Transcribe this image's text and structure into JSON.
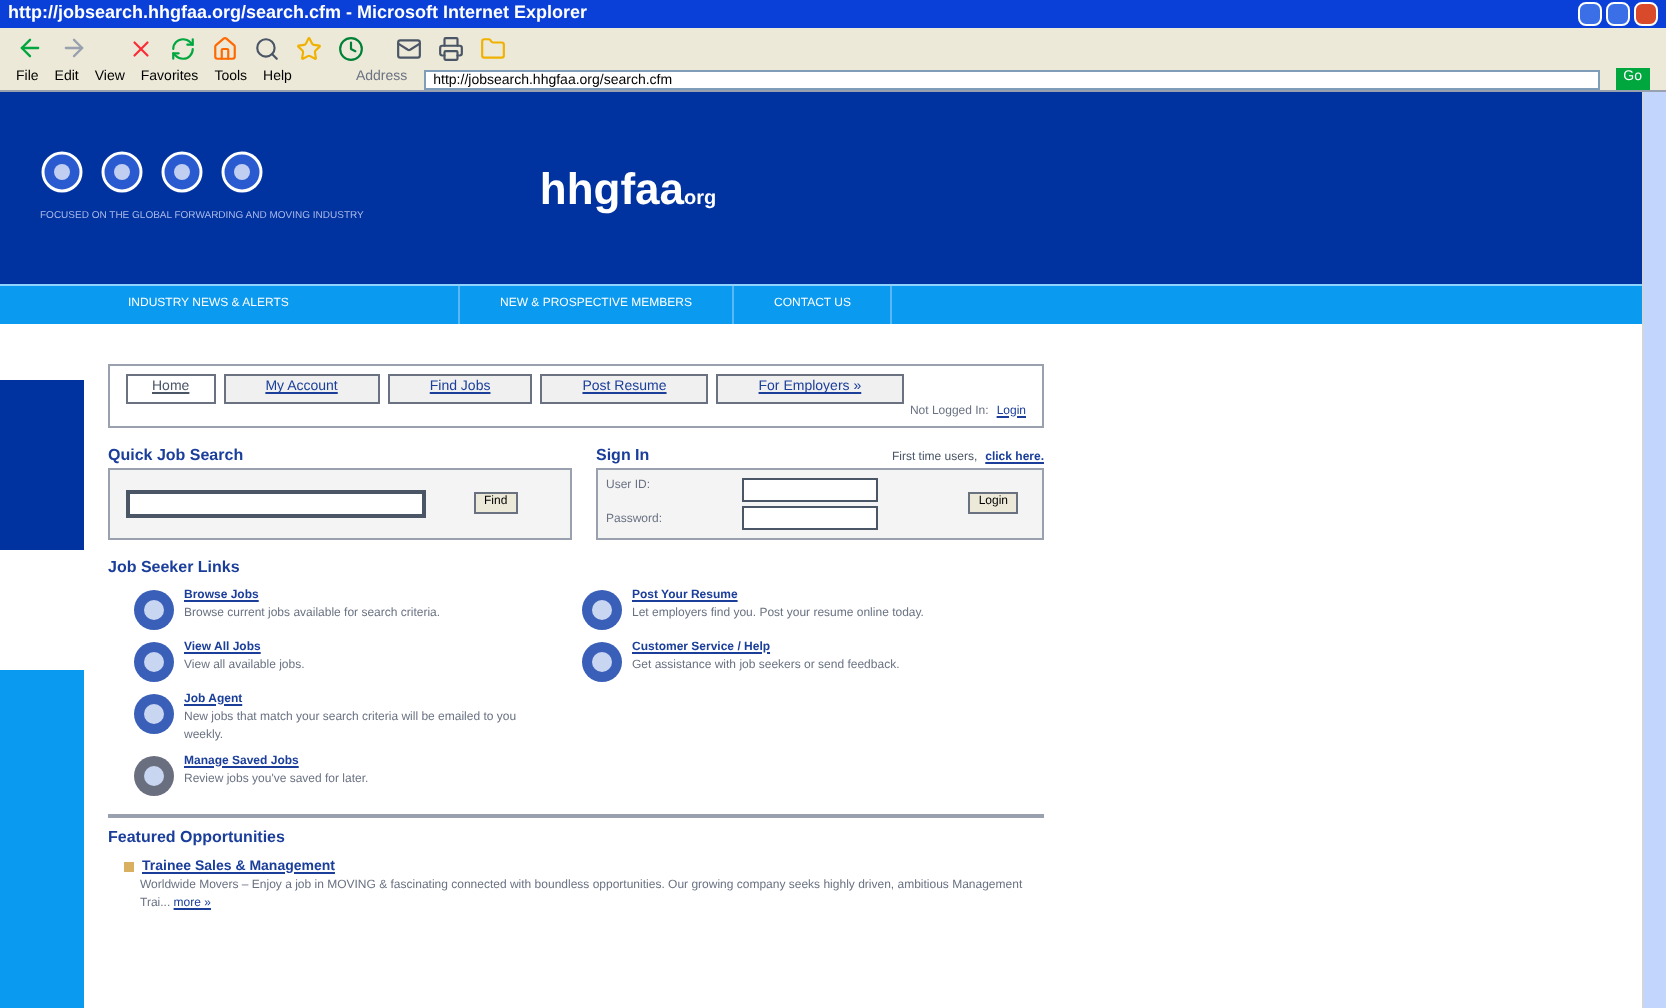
{
  "window": {
    "title": "http://jobsearch.hhgfaa.org/search.cfm - Microsoft Internet Explorer"
  },
  "menu": [
    "File",
    "Edit",
    "View",
    "Favorites",
    "Tools",
    "Help"
  ],
  "address": {
    "label": "Address",
    "value": "http://jobsearch.hhgfaa.org/search.cfm",
    "go": "Go"
  },
  "header": {
    "logo": "hhgfaa",
    "logo_suffix": "org",
    "tagline": "FOCUSED ON THE GLOBAL FORWARDING AND MOVING INDUSTRY"
  },
  "nav": [
    {
      "label": "INDUSTRY NEWS & ALERTS"
    },
    {
      "label": "NEW & PROSPECTIVE MEMBERS"
    },
    {
      "label": "CONTACT US"
    }
  ],
  "tabs": [
    {
      "label": "Home",
      "selected": true
    },
    {
      "label": "My Account",
      "selected": false
    },
    {
      "label": "Find Jobs",
      "selected": false
    },
    {
      "label": "Post Resume",
      "selected": false
    },
    {
      "label": "For Employers »",
      "selected": false
    }
  ],
  "login_status": {
    "text": "Not Logged In:",
    "link": "Login"
  },
  "quick_search": {
    "title": "Quick Job Search",
    "button": "Find"
  },
  "sign_in": {
    "title": "Sign In",
    "prompt": "First time users,",
    "prompt_link": "click here.",
    "user_label": "User ID:",
    "password_label": "Password:",
    "button": "Login"
  },
  "job_seeker_links": {
    "title": "Job Seeker Links",
    "items": [
      {
        "title": "Browse Jobs",
        "text": "Browse current jobs available for search criteria."
      },
      {
        "title": "Post Your Resume",
        "text": "Let employers find you. Post your resume online today."
      },
      {
        "title": "View All Jobs",
        "text": "View all available jobs."
      },
      {
        "title": "Customer Service / Help",
        "text": "Get assistance with job seekers or send feedback."
      },
      {
        "title": "Job Agent",
        "text": "New jobs that match your search criteria will be emailed to you weekly."
      },
      {
        "title": "Manage Saved Jobs",
        "text": "Review jobs you've saved for later."
      }
    ]
  },
  "featured": {
    "title": "Featured Opportunities",
    "items": [
      {
        "title": "Trainee Sales & Management",
        "text": "Worldwide Movers – Enjoy a job in MOVING & fascinating connected with boundless opportunities. Our growing company seeks highly driven, ambitious Management Trai...",
        "more": "more »"
      }
    ]
  }
}
